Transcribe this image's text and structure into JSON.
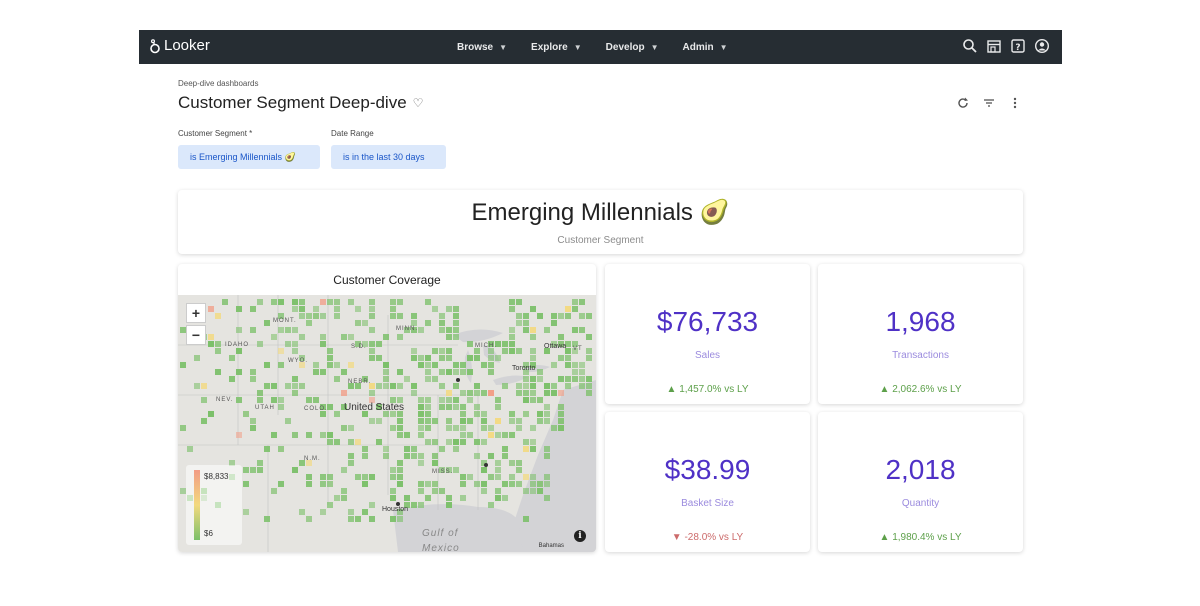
{
  "app": {
    "name": "Looker"
  },
  "nav": {
    "items": [
      {
        "label": "Browse"
      },
      {
        "label": "Explore"
      },
      {
        "label": "Develop"
      },
      {
        "label": "Admin"
      }
    ],
    "icons": [
      "search-icon",
      "marketplace-icon",
      "help-icon",
      "account-icon"
    ]
  },
  "header": {
    "breadcrumb": "Deep-dive dashboards",
    "title": "Customer Segment Deep-dive",
    "icons": [
      "refresh-icon",
      "filter-icon",
      "more-vert-icon"
    ]
  },
  "filters": [
    {
      "label": "Customer Segment *",
      "value": "is Emerging Millennials 🥑"
    },
    {
      "label": "Date Range",
      "value": "is in the last 30 days"
    }
  ],
  "segment_tile": {
    "name": "Emerging Millennials 🥑",
    "subtitle": "Customer Segment"
  },
  "map_tile": {
    "title": "Customer Coverage",
    "zoom_in": "+",
    "zoom_out": "−",
    "legend_max": "$8,833",
    "legend_min": "$6",
    "attribution": "Bahamas",
    "labels": {
      "mont": "MONT.",
      "idaho": "IDAHO",
      "wyo": "WYO.",
      "sd": "S.D.",
      "minn": "MINN.",
      "mich": "MICH.",
      "ottawa": "Ottawa",
      "vt": "VT",
      "nebr": "NEBR.",
      "toronto": "Toronto",
      "nev": "NEV.",
      "utah": "UTAH",
      "colo": "COLO.",
      "us": "United States",
      "nm": "N.M.",
      "miss": "MISS.",
      "houston": "Houston",
      "gulf": "Gulf of",
      "mexico": "Mexico"
    },
    "colors": {
      "low": "#7cc06a",
      "mid": "#f3d97e",
      "high": "#f29c85"
    }
  },
  "kpis": [
    {
      "value": "$76,733",
      "label": "Sales",
      "change": "1,457.0% vs LY",
      "direction": "up"
    },
    {
      "value": "1,968",
      "label": "Transactions",
      "change": "2,062.6% vs LY",
      "direction": "up"
    },
    {
      "value": "$38.99",
      "label": "Basket Size",
      "change": "-28.0% vs LY",
      "direction": "down"
    },
    {
      "value": "2,018",
      "label": "Quantity",
      "change": "1,980.4% vs LY",
      "direction": "up"
    }
  ],
  "colors": {
    "topbar": "#262d33",
    "accent": "#4f31c6",
    "chip_bg": "#dbe8fb",
    "chip_text": "#1a56c8",
    "up": "#5da04a",
    "down": "#cc6b6b"
  }
}
